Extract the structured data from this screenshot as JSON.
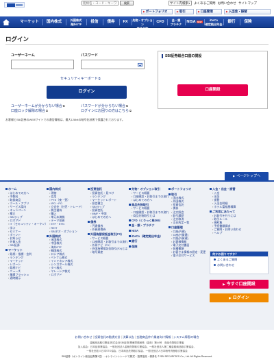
{
  "header": {
    "search_placeholder": "銘柄名・コード・キーワード",
    "search_button": "検索",
    "site_select": "サイト内検索",
    "utility_links": [
      "よくあるご質問",
      "お問い合わせ",
      "サイトマップ"
    ],
    "quick_buttons": [
      "ポートフォリオ",
      "取引",
      "口座管理",
      "入出金・振替"
    ]
  },
  "nav": {
    "items": [
      "マーケット",
      "国内株式",
      "外国株式\n海外ETF",
      "投信",
      "債券",
      "FX",
      "先物・オプション\n商品先物",
      "CFD",
      "金・銀\nプラチナ",
      "NISA",
      "iDeCo\n確定拠出年金",
      "銀行",
      "保険"
    ],
    "nisa_badge": "NEW",
    "ideco_badge": "NEW"
  },
  "login": {
    "title": "ログイン",
    "username_label": "ユーザーネーム",
    "password_label": "パスワード",
    "keyboard_link": "セキュリティキーボード",
    "login_button": "ログイン",
    "forgot_username": "ユーザーネームが分からない場合",
    "forgot_password": "パスワードが分からない場合",
    "unlock_account": "口座ロック解除の場合",
    "trouble_login": "ログインにお困りの方はこちら",
    "note": "お客様とSBI証券のWEBサイトでの通信情報は、最大128bitの暗号化技術で保護されております。"
  },
  "open_account": {
    "title": "SBI証券総合口座の開設",
    "button": "口座開設"
  },
  "pagetop": "ページトップへ",
  "sitemap": {
    "columns": [
      [
        {
          "head": "ホーム",
          "links": [
            "はじめての方へ",
            "手数料",
            "取扱商品",
            "ツール・アプリ",
            "サービス案内",
            "キャンペーン",
            "積立",
            "SBIラップ",
            "ロボアド",
            "IT（セキュリティ・キーケン）",
            "学ぶ",
            "セミナー",
            "ポイント",
            "お知らせ",
            "外貨入金",
            "SBI証券"
          ]
        },
        {
          "head": "マーケット",
          "links": [
            "銘柄・指標・金利",
            "ランキング",
            "マーケット",
            "レポート",
            "銘柄ナビ",
            "ニュース",
            "業績フラッシュ",
            "適時開示"
          ]
        }
      ],
      [
        {
          "head": "国内株式",
          "links": [
            "現物",
            "信用",
            "PTS（夜・昼）",
            "IPO・PO",
            "立会外（分売・トレード）",
            "株主優待",
            "購入",
            "単元未満株",
            "テーマ投資",
            "ETF・ETN",
            "REIT",
            "SBIネオ・オプション"
          ]
        },
        {
          "head": "外国株式",
          "links": [
            "米国株式",
            "中国株式",
            "海外ETF",
            "韓国株式",
            "ロシア株式",
            "ベトナム株式",
            "インドネシア株式",
            "シンガポール株式",
            "タイ株式",
            "マレーシア株式",
            "ロボアド"
          ]
        }
      ],
      [
        {
          "head": "投資信託",
          "links": [
            "投資信託・見つけ",
            "ランキング",
            "マーケットレポート",
            "投信積立",
            "SBIラップ",
            "投資信託",
            "MMF・中国",
            "はじめての方へ"
          ]
        },
        {
          "head": "債券",
          "links": [
            "円建債券",
            "外貨建債券"
          ]
        },
        {
          "head": "外国為替保証金取引(FX)",
          "links": [
            "サービス概要",
            "口座開設・お取引までの流れ",
            "外為ナビ（FX）",
            "外国為替保証金取引(FX)とは",
            "暗号資産"
          ]
        }
      ],
      [
        {
          "head": "先物・オプション取引",
          "links": [
            "サービス概要",
            "口座開設・お取引までの流れ",
            "はじめての方へ"
          ]
        },
        {
          "head": "商品先物取引",
          "links": [
            "サービス概要",
            "口座開設・お取引までの流れ",
            "商品先物取引とは"
          ]
        },
        {
          "head": "CFD（くりっく株365）",
          "links": []
        },
        {
          "head": "金・銀・プラチナ",
          "links": []
        },
        {
          "head": "NISA",
          "links": []
        },
        {
          "head": "iDeCo（確定拠出年金）",
          "links": []
        },
        {
          "head": "銀行",
          "links": []
        },
        {
          "head": "保険",
          "links": []
        }
      ],
      [
        {
          "head": "ポートフォリオ",
          "links": []
        },
        {
          "head": "取引",
          "links": [
            "国内株式",
            "外国株式",
            "投資信託",
            "債券",
            "注文照会",
            "取引履歴",
            "注文取消",
            "当日約定一覧"
          ]
        },
        {
          "head": "口座管理",
          "links": [
            "口座(円建)",
            "口座(外貨建)",
            "口座(外貨建)",
            "お客様情報",
            "電子交付書面",
            "各種書類",
            "お客さま情報の設定・変更",
            "電子交付サービス"
          ]
        }
      ],
      [
        {
          "head": "入金・出金・振替",
          "links": [
            "入金",
            "出金",
            "振替",
            "入出金明細",
            "ホテル富裕層精算"
          ]
        },
        {
          "head": "ご利用にあたって",
          "links": [
            "お取引を行うには",
            "取引ルール",
            "規約集",
            "手続書類請求",
            "ご質問・お問い合わせ",
            "ヘルプ"
          ]
        }
      ]
    ],
    "side_title": "何かお困りですか？",
    "side_items": [
      "よくあるご質問",
      "お問い合わせ"
    ],
    "side_open": "今すぐ口座開設",
    "side_login": "ログイン"
  },
  "footer": {
    "links": [
      "お問い合わせ",
      "投資信託の勧誘方針",
      "決算公告",
      "金融商品仲介業者向け情報",
      "システム障害の場合"
    ],
    "legal1": "金融商品取引業者 株式会社SBI証券 関東財務局長（金商）第44号　商品先物取引業者",
    "legal2": "加入協会：日本証券業協会、一般社団法人金融先物取引業協会、一般社団法人第二種金融商品取引業協会、",
    "legal3": "一般社団法人日本STO協会、日本商品先物取引協会、一般社団法人日本暗号資産取引業協会",
    "copyright": "SBI証券（オンライン総合証券第1位）- オンライントレードで株式・投資信託・債券を © SBI SECURITIES Co., Ltd. All Rights Reserved."
  },
  "colors": {
    "nav_blue": "#1a4aa8",
    "login_button": "#123c8f",
    "open_button": "#e6004e",
    "login_side": "#f08a00"
  }
}
